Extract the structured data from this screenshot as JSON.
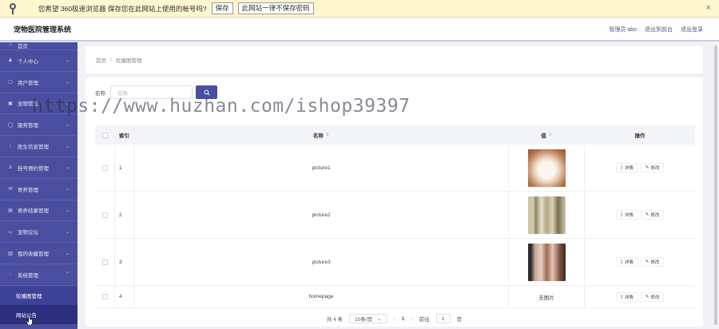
{
  "password_bar": {
    "message": "您希望 360极速浏览器 保存您在此网站上使用的帐号吗?",
    "save_label": "保存",
    "never_label": "此网站一律不保存密码",
    "close": "×"
  },
  "header": {
    "title": "宠物医院管理系统",
    "user": "管理员 abo",
    "back_label": "退出到前台",
    "logout_label": "退出登录"
  },
  "sidebar": {
    "items": [
      {
        "label": "首页"
      },
      {
        "label": "个人中心"
      },
      {
        "label": "用户管理"
      },
      {
        "label": "宠物管理"
      },
      {
        "label": "服务管理"
      },
      {
        "label": "医生信息管理"
      },
      {
        "label": "挂号预约管理"
      },
      {
        "label": "寄养管理"
      },
      {
        "label": "寄养结果管理"
      },
      {
        "label": "宠物论坛"
      },
      {
        "label": "我的收藏管理"
      },
      {
        "label": "系统管理"
      }
    ],
    "sub_items": [
      {
        "label": "轮播图管理"
      },
      {
        "label": "网站公告"
      }
    ]
  },
  "breadcrumb": {
    "home": "首页",
    "sep": "/",
    "current": "轮播图管理"
  },
  "search": {
    "label": "名称",
    "placeholder": "名称"
  },
  "table": {
    "headers": {
      "index": "索引",
      "name": "名称",
      "value": "值",
      "ops": "操作"
    },
    "rows": [
      {
        "index": "1",
        "name": "picture1",
        "value": ""
      },
      {
        "index": "2",
        "name": "picture2",
        "value": ""
      },
      {
        "index": "3",
        "name": "picture3",
        "value": ""
      },
      {
        "index": "4",
        "name": "homepage",
        "value": "无图片"
      }
    ],
    "detail_label": "详情",
    "edit_label": "修改"
  },
  "pagination": {
    "total": "共 4 条",
    "page_size": "10条/页",
    "current_page": "1",
    "goto_label": "前往",
    "goto_value": "1",
    "page_unit": "页"
  },
  "watermark": "https://www.huzhan.com/ishop39397",
  "colors": {
    "sidebar": "#4a4e9e",
    "accent": "#4a4e9e",
    "password_bar": "#fdf6cf"
  }
}
